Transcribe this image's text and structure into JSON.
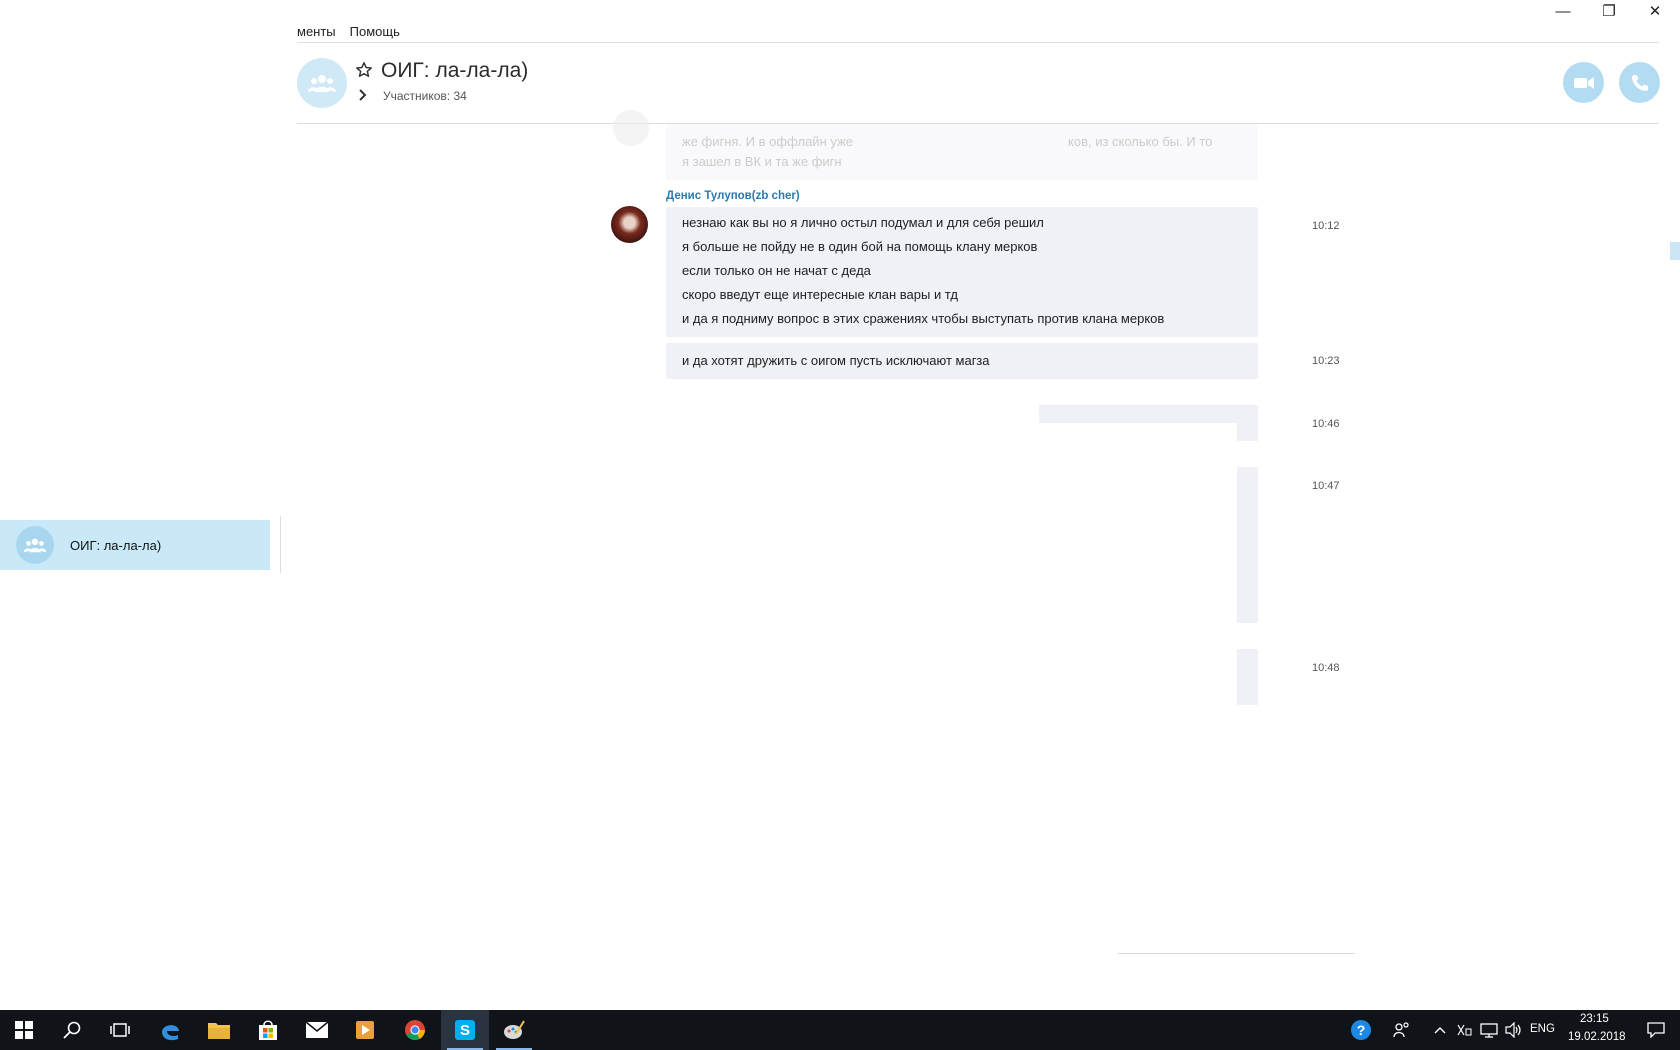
{
  "window": {
    "minimize_glyph": "—",
    "maximize_glyph": "❐",
    "close_glyph": "✕"
  },
  "menu": {
    "items": [
      {
        "label": "менты"
      },
      {
        "label": "Помощь"
      }
    ]
  },
  "header": {
    "title": "ОИГ: ла-ла-ла)",
    "members": "Участников: 34",
    "icons": [
      "group-icon",
      "star-icon",
      "chevron-right-icon",
      "video-call-icon",
      "phone-call-icon"
    ]
  },
  "sidebar": {
    "active_chat": {
      "name": "ОИГ: ла-ла-ла)"
    }
  },
  "conversation": {
    "faded_fragments": [
      "же фигня. И в оффлайн уже",
      "я зашел в ВК и та же фигн",
      "ков, из сколько бы. И то"
    ],
    "sender": "Денис Тулупов(zb cher)",
    "messages": [
      {
        "time": "10:12",
        "lines": [
          "незнаю как вы но я лично остыл подумал и для себя решил",
          "я больше не пойду не в один бой на помощь клану мерков",
          "если только он не начат с деда",
          "скоро введут еще интересные клан вары и тд",
          "и да я подниму вопрос в этих сражениях чтобы выступать против клана мерков"
        ]
      },
      {
        "time": "10:23",
        "lines": [
          "и да хотят дружить с оигом пусть исключают магза"
        ]
      },
      {
        "time": "10:46",
        "lines": []
      },
      {
        "time": "10:47",
        "lines": []
      },
      {
        "time": "10:48",
        "lines": []
      }
    ]
  },
  "taskbar": {
    "apps": [
      "windows-start-icon",
      "search-icon",
      "task-view-icon",
      "edge-icon",
      "file-explorer-icon",
      "store-icon",
      "mail-icon",
      "media-player-icon",
      "chrome-icon",
      "skype-icon",
      "paint-icon"
    ],
    "tray": {
      "language": "ENG",
      "time": "23:15",
      "date": "19.02.2018"
    }
  }
}
